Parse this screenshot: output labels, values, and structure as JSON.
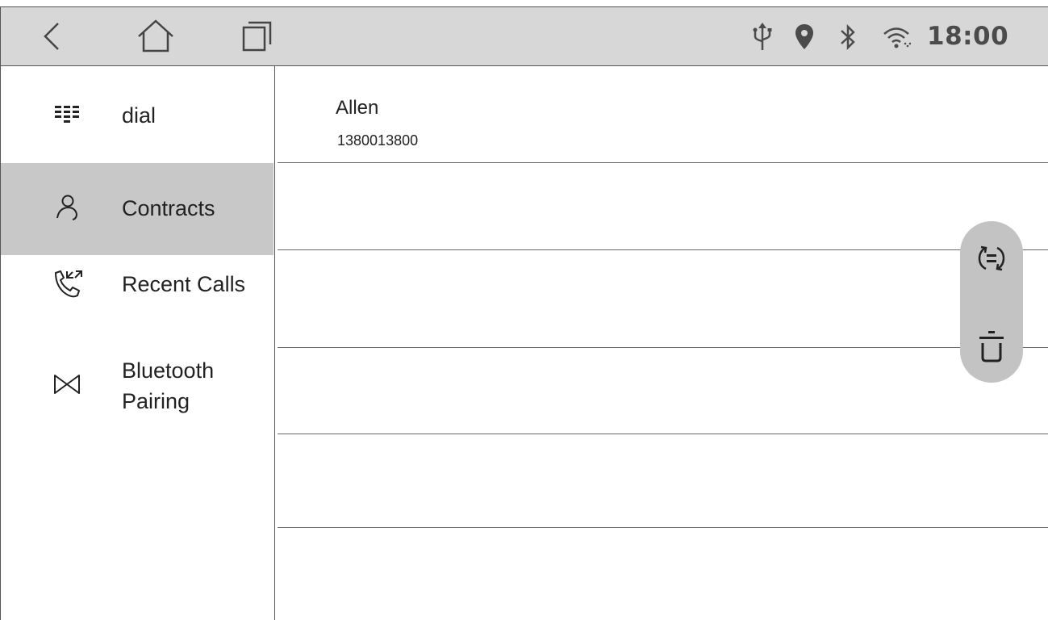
{
  "status_bar": {
    "time": "18:00",
    "icons": [
      "usb-icon",
      "location-icon",
      "bluetooth-icon",
      "wifi-icon"
    ]
  },
  "nav": {
    "icons": [
      "back-icon",
      "home-icon",
      "recent-apps-icon"
    ]
  },
  "sidebar": {
    "items": [
      {
        "label": "dial",
        "icon": "dialpad-icon",
        "active": false
      },
      {
        "label": "Contracts",
        "icon": "person-icon",
        "active": true
      },
      {
        "label": "Recent Calls",
        "icon": "call-log-icon",
        "active": false
      },
      {
        "label": "Bluetooth Pairing",
        "icon": "bluetooth-pairing-icon",
        "active": false
      }
    ]
  },
  "contacts": [
    {
      "name": "Allen",
      "number": "1380013800"
    }
  ],
  "actions": {
    "icons": [
      "sync-icon",
      "delete-icon"
    ]
  },
  "colors": {
    "status_bar_bg": "#d7d7d7",
    "active_item_bg": "#c8c8c8",
    "fab_bg": "#c3c3c3",
    "clock": "#4b4b4b"
  }
}
